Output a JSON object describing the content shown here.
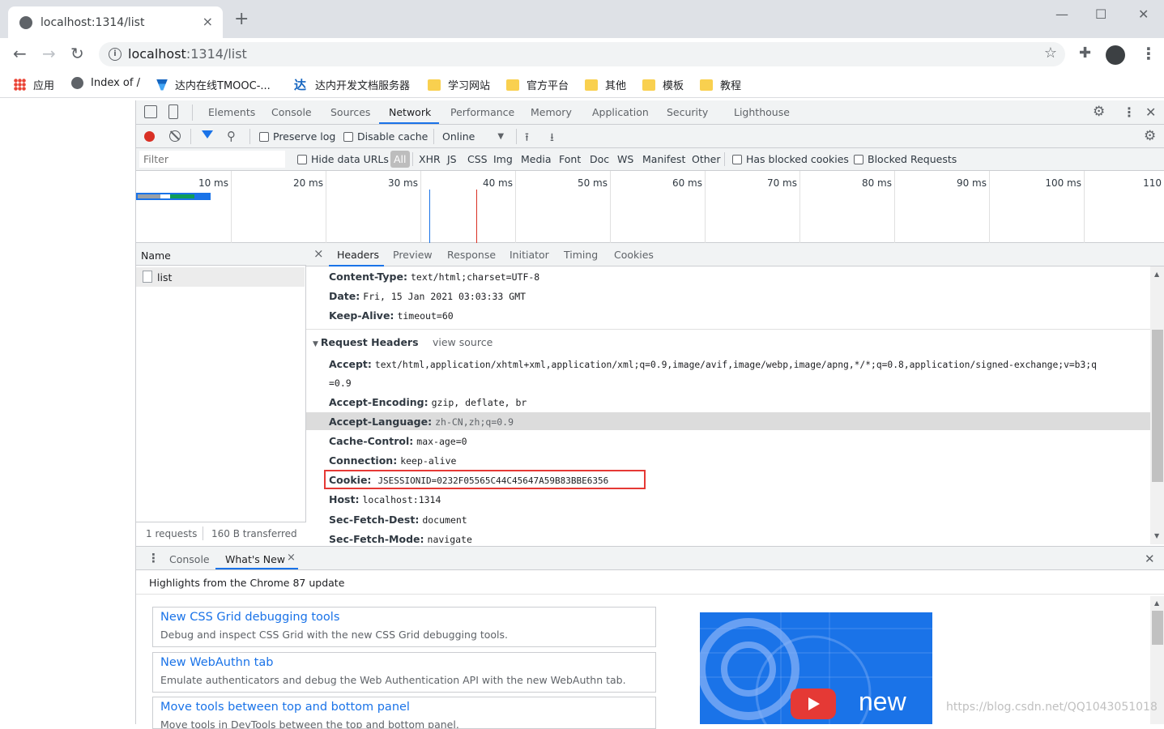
{
  "browser": {
    "tab_title": "localhost:1314/list",
    "tab_close": "×",
    "new_tab": "+",
    "url_host": "localhost",
    "url_rest": ":1314/list",
    "minimize": "—",
    "maximize": "☐",
    "close": "✕"
  },
  "bookmarks": [
    {
      "label": "应用",
      "icon": "apps-grid-icon"
    },
    {
      "label": "Index of /",
      "icon": "globe-icon"
    },
    {
      "label": "达内在线TMOOC-...",
      "icon": "tmooc-icon"
    },
    {
      "label": "达内开发文档服务器",
      "icon": "tarena-icon"
    },
    {
      "label": "学习网站",
      "icon": "folder-icon"
    },
    {
      "label": "官方平台",
      "icon": "folder-icon"
    },
    {
      "label": "其他",
      "icon": "folder-icon"
    },
    {
      "label": "模板",
      "icon": "folder-icon"
    },
    {
      "label": "教程",
      "icon": "folder-icon"
    }
  ],
  "devtools": {
    "tabs": [
      "Elements",
      "Console",
      "Sources",
      "Network",
      "Performance",
      "Memory",
      "Application",
      "Security",
      "Lighthouse"
    ],
    "active_tab": "Network",
    "toolbar": {
      "preserve_log": "Preserve log",
      "disable_cache": "Disable cache",
      "throttle": "Online"
    },
    "filter": {
      "placeholder": "Filter",
      "hide_data_urls": "Hide data URLs",
      "types": [
        "All",
        "XHR",
        "JS",
        "CSS",
        "Img",
        "Media",
        "Font",
        "Doc",
        "WS",
        "Manifest",
        "Other"
      ],
      "has_blocked_cookies": "Has blocked cookies",
      "blocked_requests": "Blocked Requests"
    },
    "timeline_ticks": [
      "10 ms",
      "20 ms",
      "30 ms",
      "40 ms",
      "50 ms",
      "60 ms",
      "70 ms",
      "80 ms",
      "90 ms",
      "100 ms",
      "110"
    ],
    "requests": {
      "name_header": "Name",
      "rows": [
        "list"
      ],
      "count": "1 requests",
      "transferred": "160 B transferred"
    },
    "details": {
      "close": "×",
      "tabs": [
        "Headers",
        "Preview",
        "Response",
        "Initiator",
        "Timing",
        "Cookies"
      ],
      "active_tab": "Headers",
      "response_headers": [
        {
          "k": "Content-Type:",
          "v": "text/html;charset=UTF-8"
        },
        {
          "k": "Date:",
          "v": "Fri, 15 Jan 2021 03:03:33 GMT"
        },
        {
          "k": "Keep-Alive:",
          "v": "timeout=60"
        }
      ],
      "request_section_title": "Request Headers",
      "view_source": "view source",
      "request_headers": [
        {
          "k": "Accept:",
          "v": "text/html,application/xhtml+xml,application/xml;q=0.9,image/avif,image/webp,image/apng,*/*;q=0.8,application/signed-exchange;v=b3;q",
          "v2": "=0.9"
        },
        {
          "k": "Accept-Encoding:",
          "v": "gzip, deflate, br"
        },
        {
          "k": "Accept-Language:",
          "v": "zh-CN,zh;q=0.9"
        },
        {
          "k": "Cache-Control:",
          "v": "max-age=0"
        },
        {
          "k": "Connection:",
          "v": "keep-alive"
        },
        {
          "k": "Cookie:",
          "v": "JSESSIONID=0232F05565C44C45647A59B83BBE6356"
        },
        {
          "k": "Host:",
          "v": "localhost:1314"
        },
        {
          "k": "Sec-Fetch-Dest:",
          "v": "document"
        },
        {
          "k": "Sec-Fetch-Mode:",
          "v": "navigate"
        }
      ]
    },
    "drawer": {
      "tabs": [
        "Console",
        "What's New"
      ],
      "active_tab": "What's New",
      "tab_close": "×",
      "close": "✕",
      "highlight": "Highlights from the Chrome 87 update",
      "cards": [
        {
          "title": "New CSS Grid debugging tools",
          "desc": "Debug and inspect CSS Grid with the new CSS Grid debugging tools."
        },
        {
          "title": "New WebAuthn tab",
          "desc": "Emulate authenticators and debug the Web Authentication API with the new WebAuthn tab."
        },
        {
          "title": "Move tools between top and bottom panel",
          "desc": "Move tools in DevTools between the top and bottom panel."
        }
      ],
      "thumb_text": "new"
    }
  },
  "watermark": "https://blog.csdn.net/QQ1043051018",
  "colors": {
    "accent": "#1a73e8",
    "record": "#d93025",
    "highlight_box": "#e53935"
  }
}
